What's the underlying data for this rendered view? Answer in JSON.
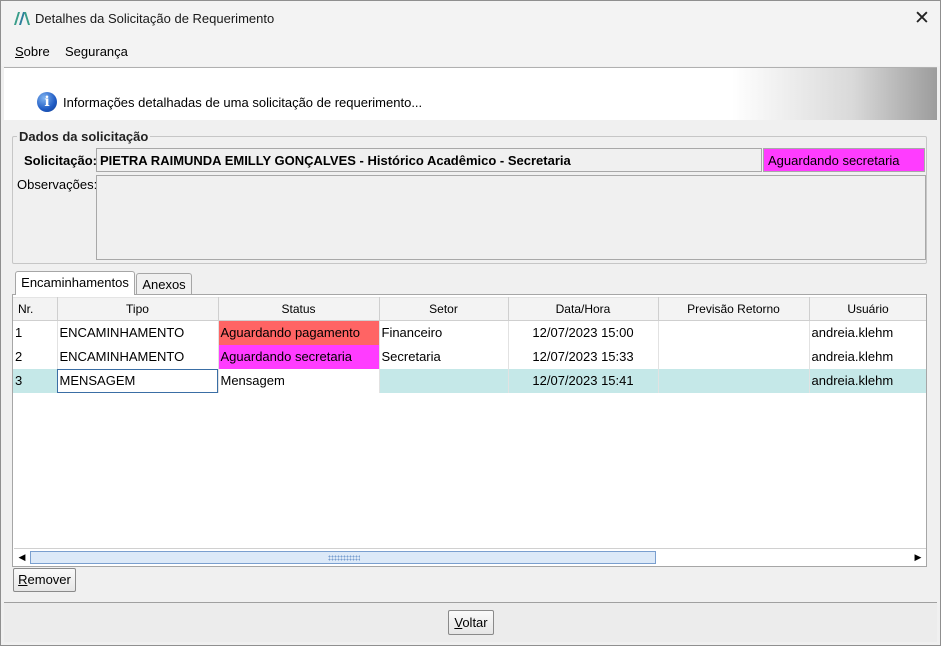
{
  "window": {
    "title": "Detalhes da Solicitação de Requerimento",
    "close_glyph": "✕"
  },
  "menu": {
    "items": [
      {
        "first": "S",
        "rest": "obre"
      },
      {
        "first": "",
        "rest": "Segurança"
      }
    ]
  },
  "banner": {
    "text": "Informações detalhadas de uma solicitação de requerimento..."
  },
  "details": {
    "group_title": "Dados da solicitação",
    "solicitacao_label": "Solicitação:",
    "solicitacao_value": "PIETRA RAIMUNDA EMILLY GONÇALVES - Histórico Acadêmico - Secretaria",
    "status_value": "Aguardando secretaria",
    "status_color": "#ff3cff",
    "observacoes_label": "Observações:",
    "observacoes_value": ""
  },
  "tabs": [
    "Encaminhamentos",
    "Anexos"
  ],
  "table": {
    "columns": [
      "Nr.",
      "Tipo",
      "Status",
      "Setor",
      "Data/Hora",
      "Previsão Retorno",
      "Usuário"
    ],
    "rows": [
      {
        "nr": "1",
        "tipo": "ENCAMINHAMENTO",
        "status": "Aguardando pagamento",
        "status_color": "#ff6464",
        "setor": "Financeiro",
        "datahora": "12/07/2023 15:00",
        "previsao": "",
        "usuario": "andreia.klehm"
      },
      {
        "nr": "2",
        "tipo": "ENCAMINHAMENTO",
        "status": "Aguardando secretaria",
        "status_color": "#ff3cff",
        "setor": "Secretaria",
        "datahora": "12/07/2023 15:33",
        "previsao": "",
        "usuario": "andreia.klehm"
      },
      {
        "nr": "3",
        "tipo": "MENSAGEM",
        "status": "Mensagem",
        "status_color": "#ffffff",
        "setor": "",
        "datahora": "12/07/2023 15:41",
        "previsao": "",
        "usuario": "andreia.klehm"
      }
    ]
  },
  "scrollbar": {
    "left_glyph": "◀",
    "right_glyph": "▶"
  },
  "buttons": {
    "remover": {
      "first": "R",
      "rest": "emover"
    },
    "voltar": {
      "first": "V",
      "rest": "oltar"
    }
  },
  "colors": {
    "selected_row": "#c5e8e8"
  }
}
